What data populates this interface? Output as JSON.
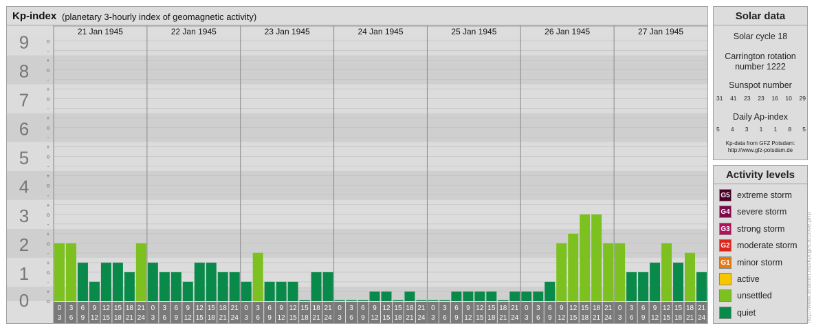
{
  "header": {
    "title": "Kp-index",
    "subtitle": "(planetary 3-hourly index of geomagnetic activity)"
  },
  "chart_data": {
    "type": "bar",
    "y_major_labels": [
      "0",
      "1",
      "2",
      "3",
      "4",
      "5",
      "6",
      "7",
      "8",
      "9"
    ],
    "y_minor_marks": [
      "+",
      "o",
      "-"
    ],
    "ylim": [
      0,
      9
    ],
    "days": [
      "21 Jan 1945",
      "22 Jan 1945",
      "23 Jan 1945",
      "24 Jan 1945",
      "25 Jan 1945",
      "26 Jan 1945",
      "27 Jan 1945"
    ],
    "slot_labels": [
      [
        "0",
        "3"
      ],
      [
        "3",
        "6"
      ],
      [
        "6",
        "9"
      ],
      [
        "9",
        "12"
      ],
      [
        "12",
        "15"
      ],
      [
        "15",
        "18"
      ],
      [
        "18",
        "21"
      ],
      [
        "21",
        "24"
      ]
    ],
    "values": [
      [
        2.0,
        2.0,
        1.33,
        0.67,
        1.33,
        1.33,
        1.0,
        2.0
      ],
      [
        1.33,
        1.0,
        1.0,
        0.67,
        1.33,
        1.33,
        1.0,
        1.0
      ],
      [
        0.67,
        1.67,
        0.67,
        0.67,
        0.67,
        0.0,
        1.0,
        1.0
      ],
      [
        0.0,
        0.0,
        0.0,
        0.33,
        0.33,
        0.0,
        0.33,
        0.0
      ],
      [
        0.0,
        0.0,
        0.33,
        0.33,
        0.33,
        0.33,
        0.0,
        0.33
      ],
      [
        0.33,
        0.33,
        0.67,
        2.0,
        2.33,
        3.0,
        3.0,
        2.0
      ],
      [
        2.0,
        1.0,
        1.0,
        1.33,
        2.0,
        1.33,
        1.67,
        1.0
      ]
    ],
    "colors": {
      "quiet": "#0a8a4a",
      "unsettled": "#7cc11f"
    }
  },
  "solar": {
    "title": "Solar data",
    "cycle": "Solar cycle 18",
    "carrington_line1": "Carrington rotation",
    "carrington_line2": "number 1222",
    "sunspot_title": "Sunspot number",
    "sunspot_values": [
      "31",
      "41",
      "23",
      "23",
      "16",
      "10",
      "29"
    ],
    "ap_title": "Daily Ap-index",
    "ap_values": [
      "5",
      "4",
      "3",
      "1",
      "1",
      "8",
      "5"
    ],
    "source_line1": "Kp-data from GFZ Potsdam:",
    "source_line2": "http://www.gfz-potsdam.de"
  },
  "activity": {
    "title": "Activity levels",
    "items": [
      {
        "code": "G5",
        "label": "extreme storm",
        "color": "#4a0026"
      },
      {
        "code": "G4",
        "label": "severe storm",
        "color": "#7a0a4a"
      },
      {
        "code": "G3",
        "label": "strong storm",
        "color": "#b0125e"
      },
      {
        "code": "G2",
        "label": "moderate storm",
        "color": "#d9261f"
      },
      {
        "code": "G1",
        "label": "minor storm",
        "color": "#e87a16"
      },
      {
        "code": "",
        "label": "active",
        "color": "#f7c600"
      },
      {
        "code": "",
        "label": "unsettled",
        "color": "#7cc11f"
      },
      {
        "code": "",
        "label": "quiet",
        "color": "#0a8a4a"
      }
    ]
  },
  "watermark": "http://www.tiedenet.etu/kpcgi/s.archive.php"
}
